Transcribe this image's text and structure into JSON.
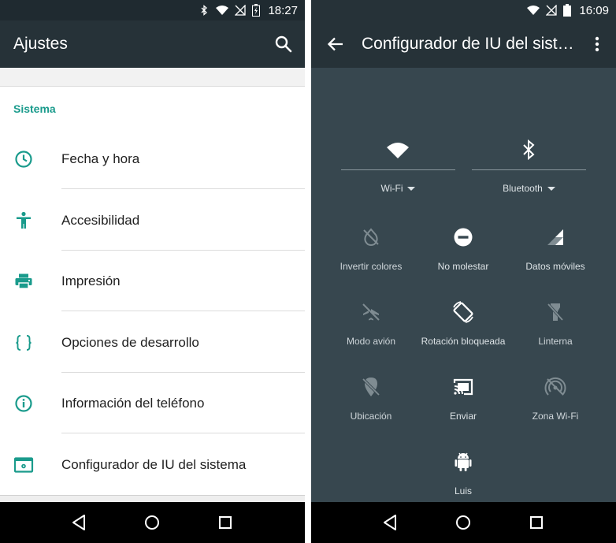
{
  "left": {
    "status_bar": {
      "time": "18:27"
    },
    "app_bar": {
      "title": "Ajustes",
      "search_icon": "search-icon"
    },
    "section_header": "Sistema",
    "items": [
      {
        "label": "Fecha y hora",
        "icon": "clock-icon"
      },
      {
        "label": "Accesibilidad",
        "icon": "accessibility-icon"
      },
      {
        "label": "Impresión",
        "icon": "printer-icon"
      },
      {
        "label": "Opciones de desarrollo",
        "icon": "braces-icon"
      },
      {
        "label": "Información del teléfono",
        "icon": "info-icon"
      },
      {
        "label": "Configurador de IU del sistema",
        "icon": "system-ui-tuner-icon"
      }
    ]
  },
  "right": {
    "status_bar": {
      "time": "16:09"
    },
    "app_bar": {
      "title": "Configurador de IU del sistema"
    },
    "big_tiles": [
      {
        "label": "Wi-Fi",
        "icon": "wifi-icon"
      },
      {
        "label": "Bluetooth",
        "icon": "bluetooth-icon"
      }
    ],
    "tiles": [
      {
        "label": "Invertir colores",
        "icon": "invert-colors-off-icon"
      },
      {
        "label": "No molestar",
        "icon": "do-not-disturb-icon"
      },
      {
        "label": "Datos móviles",
        "icon": "cellular-signal-icon"
      },
      {
        "label": "Modo avión",
        "icon": "airplane-off-icon"
      },
      {
        "label": "Rotación bloqueada",
        "icon": "rotation-lock-icon"
      },
      {
        "label": "Linterna",
        "icon": "flashlight-off-icon"
      },
      {
        "label": "Ubicación",
        "icon": "location-off-icon"
      },
      {
        "label": "Enviar",
        "icon": "cast-icon"
      },
      {
        "label": "Zona Wi-Fi",
        "icon": "hotspot-off-icon"
      },
      {
        "label": "Luis",
        "icon": "android-user-icon"
      }
    ]
  },
  "colors": {
    "accent_teal": "#1a9b8c",
    "app_bar": "#263238",
    "panel": "#37474f",
    "nav_bar": "#000000"
  }
}
